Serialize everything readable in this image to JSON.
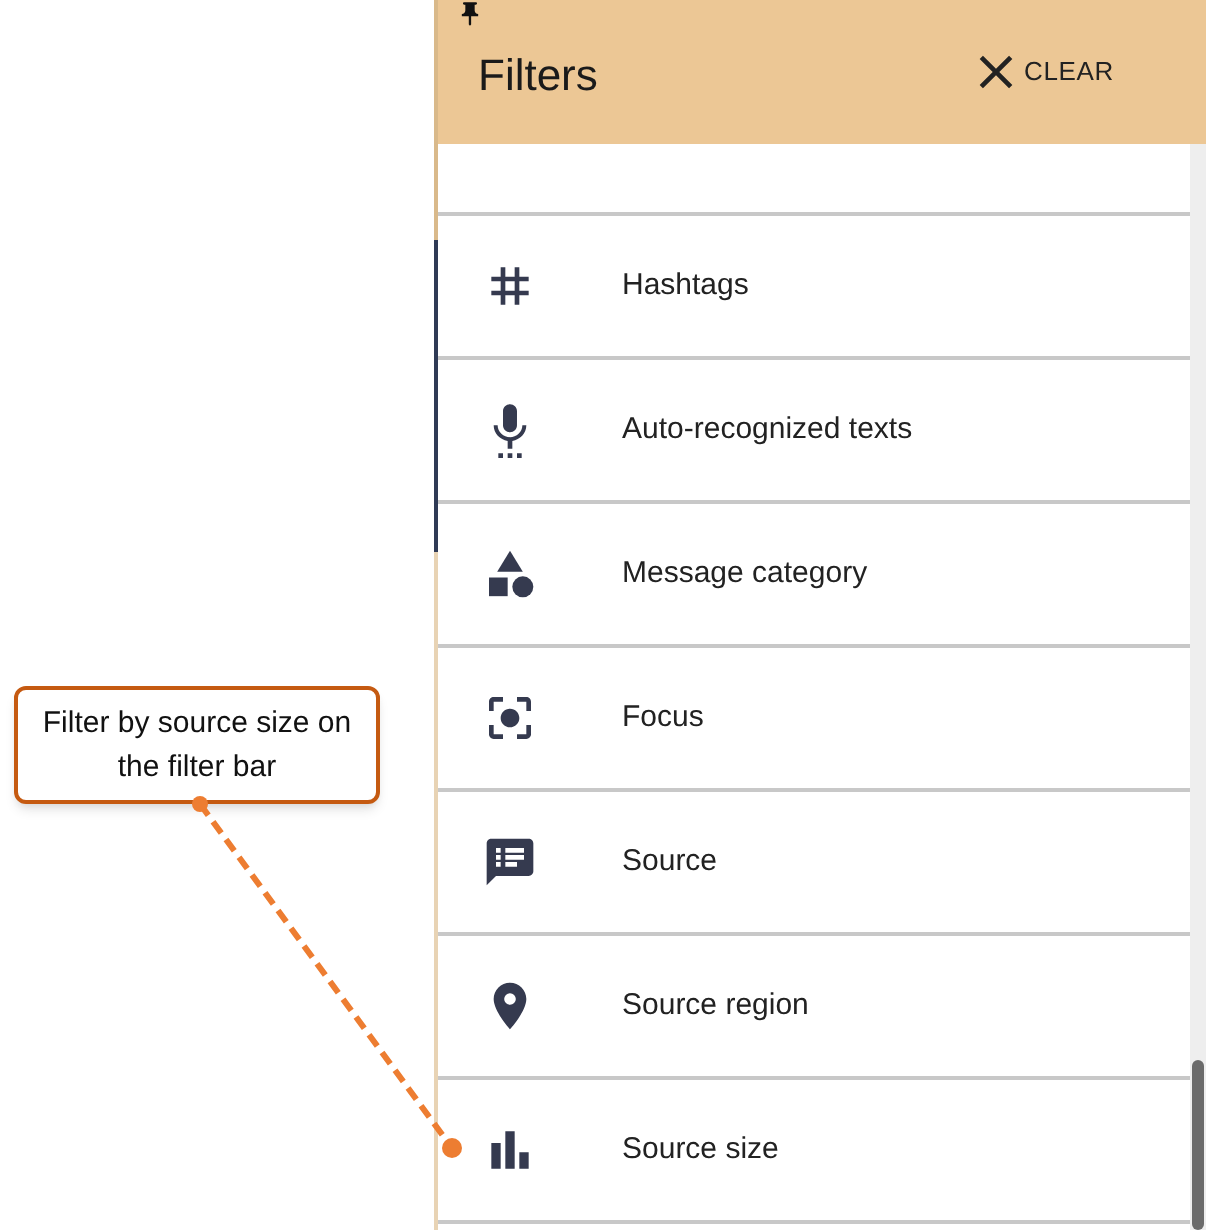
{
  "panel": {
    "title": "Filters",
    "clear_button": "CLEAR"
  },
  "filters": [
    {
      "label": "Hashtags"
    },
    {
      "label": "Auto-recognized texts"
    },
    {
      "label": "Message category"
    },
    {
      "label": "Focus"
    },
    {
      "label": "Source"
    },
    {
      "label": "Source region"
    },
    {
      "label": "Source size"
    }
  ],
  "callout": {
    "text": "Filter by source size on the filter bar"
  }
}
